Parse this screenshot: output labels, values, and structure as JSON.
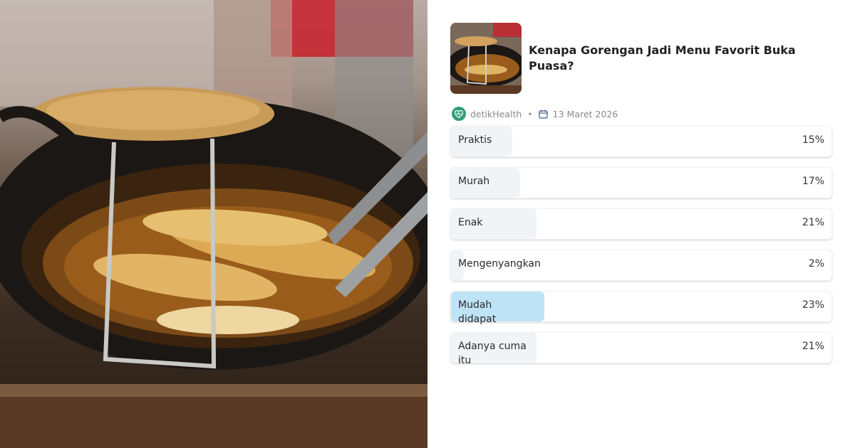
{
  "article": {
    "title": "Kenapa Gorengan Jadi Menu Favorit Buka Puasa?",
    "source": "detikHealth",
    "date": "13 Maret 2026"
  },
  "colors": {
    "accent_fill": "#bfe3f6",
    "default_fill": "#f1f4f7",
    "brand_icon": "#2f9e78"
  },
  "icons": {
    "brand": "heart-logo-icon",
    "date": "calendar-icon"
  },
  "poll": {
    "options": [
      {
        "label": "Praktis",
        "percent": "15%",
        "value": 15
      },
      {
        "label": "Murah",
        "percent": "17%",
        "value": 17
      },
      {
        "label": "Enak",
        "percent": "21%",
        "value": 21
      },
      {
        "label": "Mengenyangkan",
        "percent": "2%",
        "value": 2
      },
      {
        "label": "Mudah didapat",
        "percent": "23%",
        "value": 23,
        "highlight": true
      },
      {
        "label": "Adanya cuma itu",
        "percent": "21%",
        "value": 21
      }
    ]
  }
}
